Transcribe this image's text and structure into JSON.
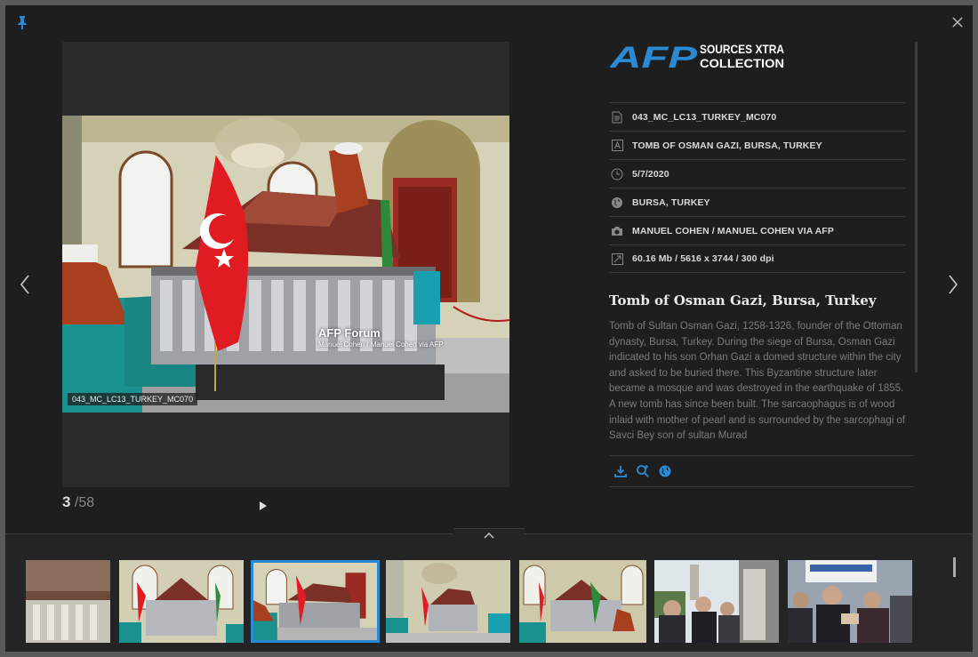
{
  "logo": {
    "mark": "AFP",
    "line1": "SOURCES XTRA",
    "line2": "COLLECTION"
  },
  "photo": {
    "watermark_title": "AFP Forum",
    "watermark_credit": "Manuel Cohen / Manuel Cohen via AFP",
    "code_badge": "043_MC_LC13_TURKEY_MC070"
  },
  "counter": {
    "current": "3",
    "total": "/58"
  },
  "meta": [
    {
      "icon": "document-icon",
      "value": "043_MC_LC13_TURKEY_MC070"
    },
    {
      "icon": "text-a-icon",
      "value": "TOMB OF OSMAN GAZI, BURSA, TURKEY"
    },
    {
      "icon": "clock-icon",
      "value": "5/7/2020"
    },
    {
      "icon": "globe-icon",
      "value": "BURSA, TURKEY"
    },
    {
      "icon": "camera-icon",
      "value": "MANUEL COHEN / MANUEL COHEN VIA AFP"
    },
    {
      "icon": "resize-icon",
      "value": "60.16 Mb / 5616 x 3744 / 300 dpi"
    }
  ],
  "caption": {
    "title": "Tomb of Osman Gazi, Bursa, Turkey",
    "text": "Tomb of Sultan Osman Gazi, 1258-1326, founder of the Ottoman dynasty, Bursa, Turkey. During the siege of Bursa, Osman Gazi indicated to his son Orhan Gazi a domed structure within the city and asked to be buried there. This Byzantine structure later became a mosque and was destroyed in the earthquake of 1855. A new tomb has since been built. The sarcaophagus is of wood inlaid with mother of pearl and is surrounded by the sarcophagi of Savci Bey son of sultan Murad"
  },
  "colors": {
    "accent": "#2a8ad4",
    "background": "#1e1e1e",
    "logo_blue": "#2a8ad4"
  }
}
